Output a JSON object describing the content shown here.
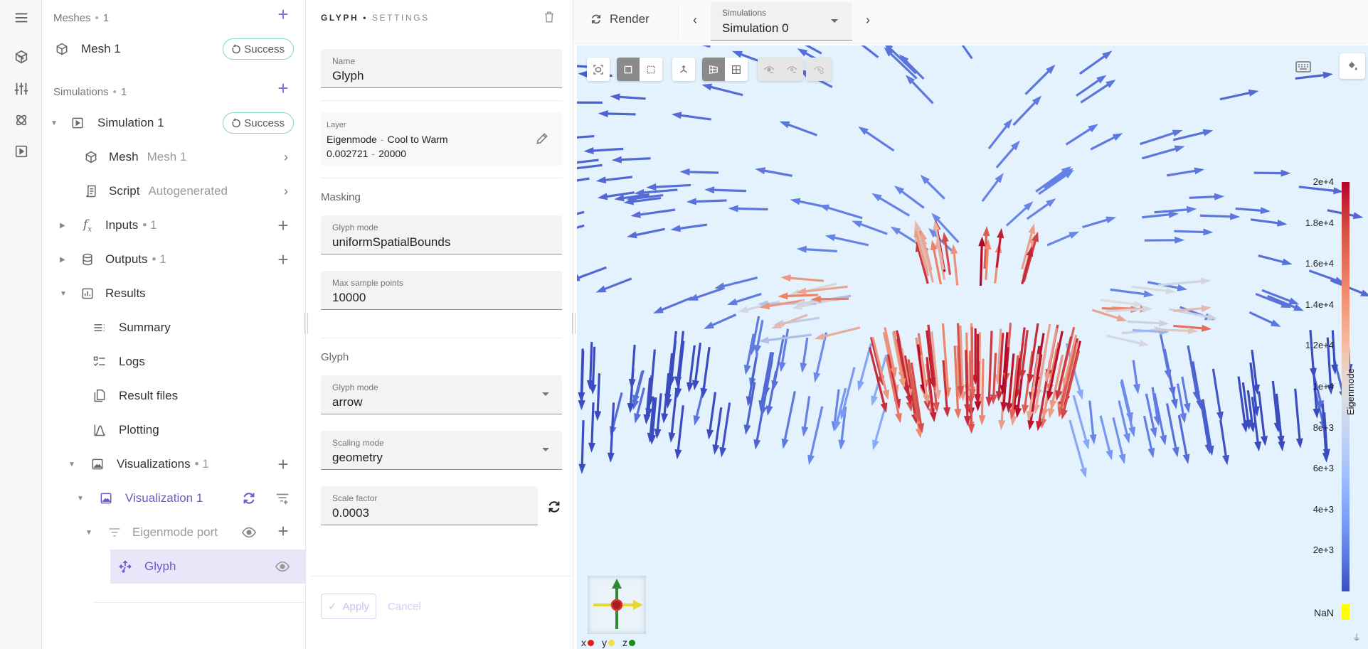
{
  "rail": {
    "items": [
      {
        "name": "menu-icon"
      },
      {
        "name": "mesh-icon"
      },
      {
        "name": "settings-sliders-icon"
      },
      {
        "name": "physics-atom-icon"
      },
      {
        "name": "simulation-play-icon"
      }
    ]
  },
  "tree": {
    "meshes": {
      "label": "Meshes",
      "count": "1"
    },
    "mesh1": {
      "label": "Mesh 1",
      "status": "Success"
    },
    "simulations": {
      "label": "Simulations",
      "count": "1"
    },
    "simulation1": {
      "label": "Simulation 1",
      "status": "Success"
    },
    "mesh": {
      "label": "Mesh",
      "value": "Mesh 1"
    },
    "script": {
      "label": "Script",
      "value": "Autogenerated"
    },
    "inputs": {
      "label": "Inputs",
      "count": "1"
    },
    "outputs": {
      "label": "Outputs",
      "count": "1"
    },
    "results": {
      "label": "Results"
    },
    "summary": {
      "label": "Summary"
    },
    "logs": {
      "label": "Logs"
    },
    "result_files": {
      "label": "Result files"
    },
    "plotting": {
      "label": "Plotting"
    },
    "visualizations": {
      "label": "Visualizations",
      "count": "1"
    },
    "visualization1": {
      "label": "Visualization 1"
    },
    "eigenmode_port": {
      "label": "Eigenmode port"
    },
    "glyph": {
      "label": "Glyph"
    },
    "count_sep": "•"
  },
  "panel": {
    "title": "GLYPH",
    "title_sep": "•",
    "subtitle": "SETTINGS",
    "name_field": {
      "label": "Name",
      "value": "Glyph"
    },
    "layer": {
      "label": "Layer",
      "field": "Eigenmode",
      "colormap": "Cool to Warm",
      "min": "0.002721",
      "max": "20000",
      "sep": "-"
    },
    "masking_header": "Masking",
    "masking_mode": {
      "label": "Glyph mode",
      "value": "uniformSpatialBounds"
    },
    "max_sample_points": {
      "label": "Max sample points",
      "value": "10000"
    },
    "glyph_header": "Glyph",
    "glyph_mode": {
      "label": "Glyph mode",
      "value": "arrow"
    },
    "scaling_mode": {
      "label": "Scaling mode",
      "value": "geometry"
    },
    "scale_factor": {
      "label": "Scale factor",
      "value": "0.0003"
    },
    "apply_label": "Apply",
    "cancel_label": "Cancel"
  },
  "viewport": {
    "render_label": "Render",
    "simulation_select": {
      "label": "Simulations",
      "value": "Simulation 0"
    },
    "toolbar": [
      {
        "name": "reset-camera-button",
        "state": "normal"
      },
      {
        "name": "surface-mode-button",
        "state": "on"
      },
      {
        "name": "wireframe-mode-button",
        "state": "normal"
      },
      {
        "name": "axes-toggle-button",
        "state": "normal"
      },
      {
        "name": "single-view-button",
        "state": "on"
      },
      {
        "name": "quad-view-button",
        "state": "normal"
      },
      {
        "name": "hide-selected-button",
        "state": "disabled"
      },
      {
        "name": "hide-others-button",
        "state": "disabled"
      },
      {
        "name": "show-all-button",
        "state": "disabled"
      }
    ],
    "colorbar": {
      "title": "Eigenmode",
      "ticks": [
        "2e+4",
        "1.8e+4",
        "1.6e+4",
        "1.4e+4",
        "1.2e+4",
        "1e+4",
        "8e+3",
        "6e+3",
        "4e+3",
        "2e+3"
      ],
      "range": [
        0.002721,
        20000
      ],
      "nan_label": "NaN",
      "nan_color": "#ffff00",
      "colors": {
        "high": "#b40426",
        "mid": "#dddddd",
        "low": "#3b4cc0"
      }
    },
    "axes_legend": [
      {
        "axis": "x",
        "color": "#e02020"
      },
      {
        "axis": "y",
        "color": "#f0e040"
      },
      {
        "axis": "z",
        "color": "#1a8a1a"
      }
    ]
  },
  "colors": {
    "accent": "#6a5acd",
    "success_border": "#7ed9bd",
    "selected_bg": "#e8e6f8",
    "canvas_bg": "#e3f2fc"
  }
}
